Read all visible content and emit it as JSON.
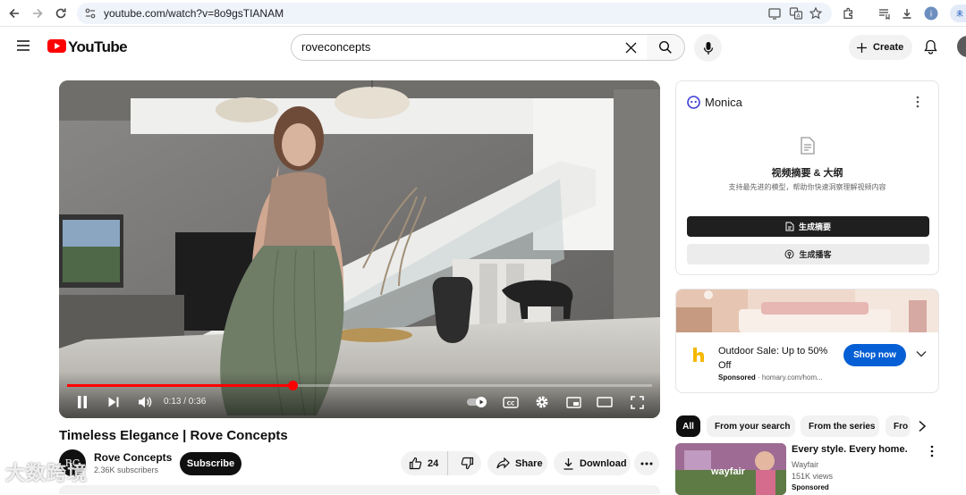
{
  "browser": {
    "url": "youtube.com/watch?v=8o9gsTIANAM",
    "lang_badge": "未"
  },
  "header": {
    "logo_text": "YouTube",
    "search_value": "roveconcepts",
    "create_label": "Create"
  },
  "player": {
    "time": "0:13 / 0:36",
    "progress": 0.3846
  },
  "video": {
    "title": "Timeless Elegance | Rove Concepts",
    "channel_name": "Rove Concepts",
    "channel_initials": "RC",
    "subscribers": "2.36K subscribers",
    "subscribe_label": "Subscribe",
    "likes": "24",
    "share_label": "Share",
    "download_label": "Download"
  },
  "monica": {
    "brand": "Monica",
    "heading": "视频摘要 & 大纲",
    "subheading": "支持最先进的模型，帮助你快速洞察理解视频内容",
    "summary_button": "生成摘要",
    "podcast_button": "生成播客"
  },
  "ad": {
    "title": "Outdoor Sale: Up to 50% Off",
    "sponsored": "Sponsored",
    "domain": "homary.com/hom...",
    "cta": "Shop now"
  },
  "chips": [
    "All",
    "From your search",
    "From the series",
    "Fro"
  ],
  "recommendation": {
    "title": "Every style. Every home.",
    "channel": "Wayfair",
    "views": "151K views",
    "sponsored": "Sponsored",
    "thumb_brand": "wayfair"
  },
  "watermark": "大数跨境",
  "colors": {
    "youtube_red": "#ff0000",
    "progress_red": "#ff0000",
    "shop_blue": "#065fd4",
    "subscribe_black": "#0f0f0f",
    "ad_logo_yellow": "#f5b800"
  }
}
